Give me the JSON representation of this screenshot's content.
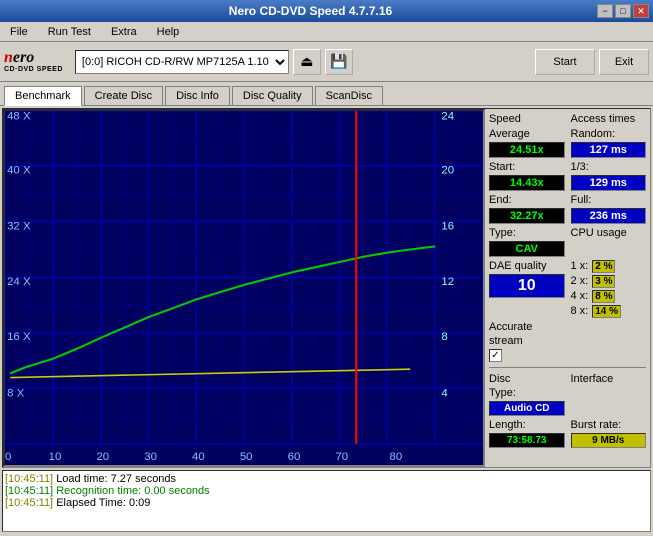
{
  "window": {
    "title": "Nero CD-DVD Speed 4.7.7.16",
    "minimize_label": "−",
    "maximize_label": "□",
    "close_label": "✕"
  },
  "menu": {
    "items": [
      "File",
      "Run Test",
      "Extra",
      "Help"
    ]
  },
  "toolbar": {
    "logo_nero": "nero",
    "logo_sub": "CD·DVD SPEED",
    "drive_label": "[0:0]  RICOH CD-R/RW MP7125A 1.10",
    "start_label": "Start",
    "exit_label": "Exit"
  },
  "tabs": {
    "items": [
      "Benchmark",
      "Create Disc",
      "Disc Info",
      "Disc Quality",
      "ScanDisc"
    ],
    "active": "Benchmark"
  },
  "chart": {
    "y_axis_left": [
      "48 X",
      "40 X",
      "32 X",
      "24 X",
      "16 X",
      "8 X"
    ],
    "y_axis_right": [
      "24",
      "20",
      "16",
      "12",
      "8",
      "4"
    ],
    "x_axis": [
      "0",
      "10",
      "20",
      "30",
      "40",
      "50",
      "60",
      "70",
      "80"
    ]
  },
  "right_panel": {
    "speed_label": "Speed",
    "access_label": "Access times",
    "average_label": "Average",
    "average_value": "24.51x",
    "random_label": "Random:",
    "random_value": "127 ms",
    "start_label": "Start:",
    "start_value": "14.43x",
    "onethird_label": "1/3:",
    "onethird_value": "129 ms",
    "end_label": "End:",
    "end_value": "32.27x",
    "full_label": "Full:",
    "full_value": "236 ms",
    "type_label": "Type:",
    "type_value": "CAV",
    "cpu_label": "CPU usage",
    "cpu_1x_label": "1 x:",
    "cpu_1x_value": "2 %",
    "cpu_2x_label": "2 x:",
    "cpu_2x_value": "3 %",
    "cpu_4x_label": "4 x:",
    "cpu_4x_value": "8 %",
    "cpu_8x_label": "8 x:",
    "cpu_8x_value": "14 %",
    "dae_label": "DAE quality",
    "dae_value": "10",
    "accurate_label": "Accurate",
    "stream_label": "stream",
    "disc_label": "Disc",
    "type2_label": "Type:",
    "disc_type_value": "Audio CD",
    "interface_label": "Interface",
    "length_label": "Length:",
    "length_value": "73:58.73",
    "burst_label": "Burst rate:",
    "burst_value": "9 MB/s"
  },
  "log": {
    "lines": [
      {
        "time": "[10:45:11]",
        "text": " Load time: 7.27 seconds",
        "color": "normal"
      },
      {
        "time": "[10:45:11]",
        "text": " Recognition time: 0.00 seconds",
        "color": "green"
      },
      {
        "time": "[10:45:11]",
        "text": " Elapsed Time: 0:09",
        "color": "normal"
      }
    ]
  }
}
